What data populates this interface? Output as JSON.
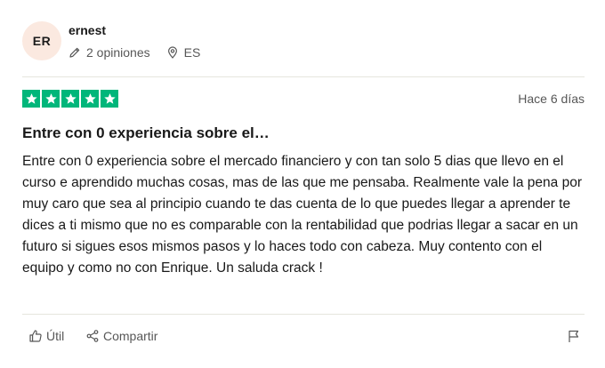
{
  "reviewer": {
    "initials": "ER",
    "name": "ernest",
    "reviews_count": "2 opiniones",
    "country": "ES",
    "avatar_bg": "#fbe9e0"
  },
  "review": {
    "rating": 5,
    "rating_max": 5,
    "star_color": "#00b67a",
    "date": "Hace 6 días",
    "title": "Entre con 0 experiencia sobre el…",
    "body": "Entre con 0 experiencia sobre el mercado financiero y con tan solo 5 dias que llevo en el curso e aprendido muchas cosas, mas de las que me pensaba. Realmente vale la pena por muy caro que sea al principio cuando te das cuenta de lo que puedes llegar a aprender te dices a ti mismo que no es comparable con la rentabilidad que podrias llegar a sacar en un futuro si sigues esos mismos pasos y lo haces todo con cabeza. Muy contento con el equipo y como no con Enrique. Un saluda crack !"
  },
  "actions": {
    "useful_label": "Útil",
    "share_label": "Compartir",
    "useful_icon": "thumbs-up-icon",
    "share_icon": "share-icon",
    "flag_icon": "flag-icon"
  },
  "icons": {
    "reviews": "pencil-icon",
    "country": "location-pin-icon"
  }
}
